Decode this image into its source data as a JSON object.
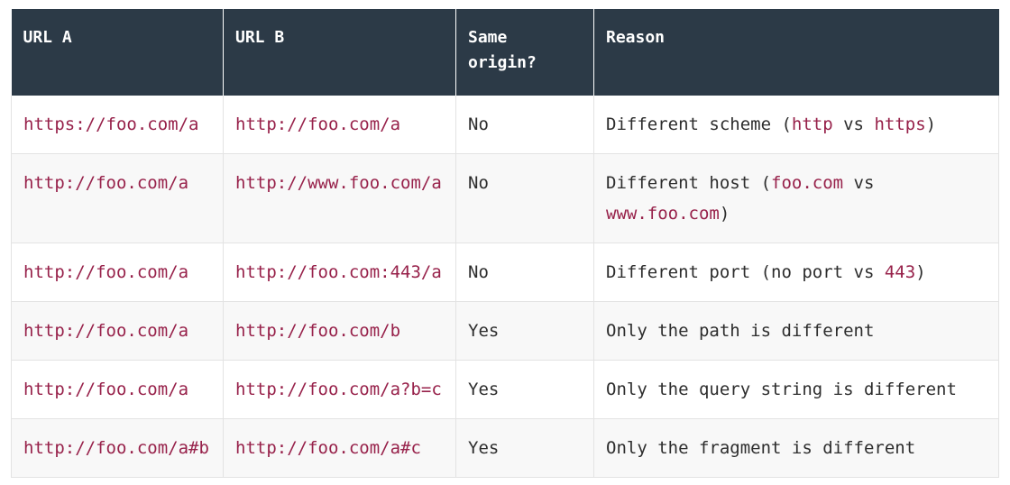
{
  "table": {
    "headers": [
      "URL A",
      "URL B",
      "Same origin?",
      "Reason"
    ],
    "rows": [
      {
        "url_a": "https://foo.com/a",
        "url_b": "http://foo.com/a",
        "same": "No",
        "reason": {
          "p1": "Different scheme (",
          "c1": "http",
          "p2": " vs ",
          "c2": "https",
          "p3": ")"
        }
      },
      {
        "url_a": "http://foo.com/a",
        "url_b": "http://www.foo.com/a",
        "same": "No",
        "reason": {
          "p1": "Different host (",
          "c1": "foo.com",
          "p2": " vs ",
          "c2": "www.foo.com",
          "p3": ")"
        }
      },
      {
        "url_a": "http://foo.com/a",
        "url_b": "http://foo.com:443/a",
        "same": "No",
        "reason": {
          "p1": "Different port (no port vs ",
          "c1": "443",
          "p2": ")"
        }
      },
      {
        "url_a": "http://foo.com/a",
        "url_b": "http://foo.com/b",
        "same": "Yes",
        "reason": {
          "p1": "Only the path is different"
        }
      },
      {
        "url_a": "http://foo.com/a",
        "url_b": "http://foo.com/a?b=c",
        "same": "Yes",
        "reason": {
          "p1": "Only the query string is different"
        }
      },
      {
        "url_a": "http://foo.com/a#b",
        "url_b": "http://foo.com/a#c",
        "same": "Yes",
        "reason": {
          "p1": "Only the fragment is different"
        }
      }
    ]
  }
}
